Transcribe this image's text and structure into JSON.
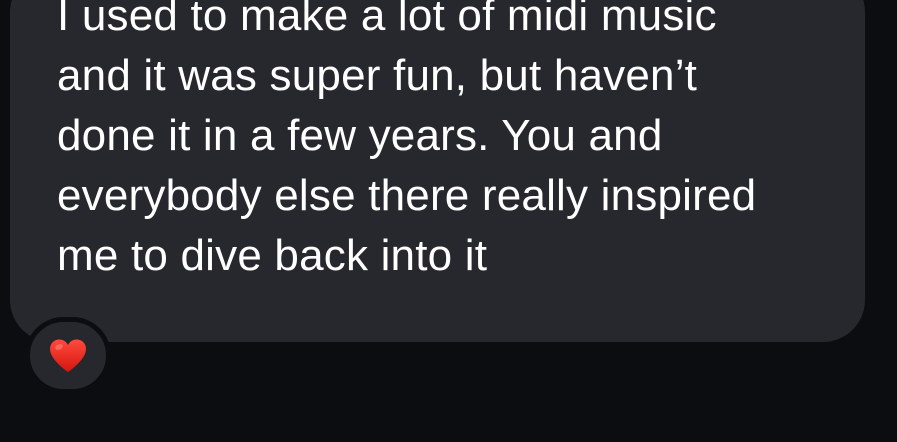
{
  "message": {
    "lines": [
      "I used to make a lot of midi music",
      "and it was super fun, but haven’t",
      "done it in a few years. You and",
      "everybody else there really inspired",
      "me to dive back into it"
    ]
  },
  "reaction": {
    "icon": "red-heart-icon",
    "color": "#e0251f"
  },
  "colors": {
    "background": "#0b0d10",
    "bubble": "#26282d",
    "text": "#ffffff"
  }
}
